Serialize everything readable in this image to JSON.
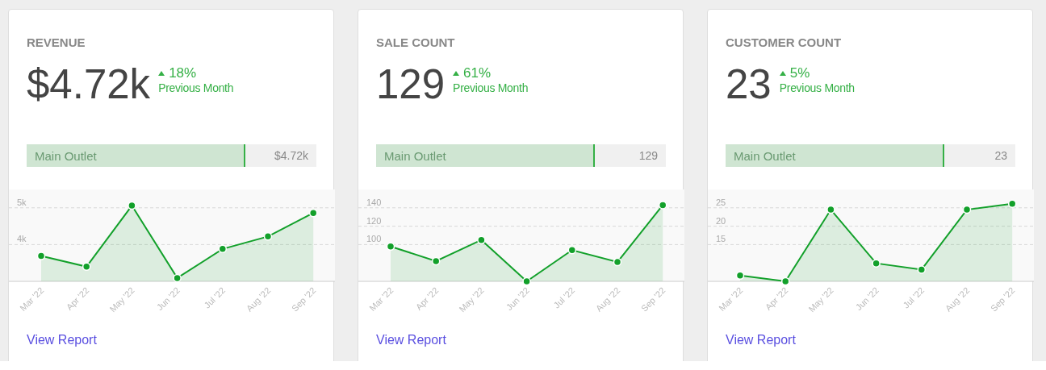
{
  "cards": [
    {
      "title": "REVENUE",
      "value": "$4.72k",
      "change": {
        "kind": "up",
        "text": "18%",
        "period": "Previous Month"
      },
      "breakdown": {
        "label": "Main Outlet",
        "level": 0.75,
        "value": "$4.72k"
      },
      "chart_data": {
        "type": "area",
        "categories": [
          "Mar '22",
          "Apr '22",
          "May '22",
          "Jun '22",
          "Jul '22",
          "Aug '22",
          "Sep '22"
        ],
        "series": [
          {
            "color": "#12a02a",
            "values": [
              3690,
              3400,
              5060,
              3090,
              3880,
              4220,
              4860
            ]
          }
        ],
        "ylim": [
          3000,
          5500
        ],
        "grid": true,
        "yticks": [
          {
            "value": 4000,
            "label": "4k"
          },
          {
            "value": 5000,
            "label": "5k"
          }
        ]
      },
      "link": "View Report"
    },
    {
      "title": "SALE COUNT",
      "value": "129",
      "change": {
        "kind": "up",
        "text": "61%",
        "period": "Previous Month"
      },
      "breakdown": {
        "label": "Main Outlet",
        "level": 0.75,
        "value": "129"
      },
      "chart_data": {
        "type": "area",
        "categories": [
          "Mar '22",
          "Apr '22",
          "May '22",
          "Jun '22",
          "Jul '22",
          "Aug '22",
          "Sep '22"
        ],
        "series": [
          {
            "color": "#12a02a",
            "values": [
              98,
              82,
              105,
              60,
              94,
              81,
              143
            ]
          }
        ],
        "ylim": [
          60,
          160
        ],
        "grid": true,
        "yticks": [
          100,
          120,
          140
        ]
      },
      "link": "View Report"
    },
    {
      "title": "CUSTOMER COUNT",
      "value": "23",
      "change": {
        "kind": "up",
        "text": "5%",
        "period": "Previous Month"
      },
      "breakdown": {
        "label": "Main Outlet",
        "level": 0.75,
        "value": "23"
      },
      "chart_data": {
        "type": "area",
        "categories": [
          "Mar '22",
          "Apr '22",
          "May '22",
          "Jun '22",
          "Jul '22",
          "Aug '22",
          "Sep '22"
        ],
        "series": [
          {
            "color": "#12a02a",
            "values": [
              6.6,
              5,
              24.5,
              9.9,
              8.2,
              24.5,
              26.1
            ]
          }
        ],
        "ylim": [
          5,
          30
        ],
        "grid": true,
        "yticks": [
          15,
          20,
          25
        ]
      },
      "link": "View Report"
    }
  ]
}
